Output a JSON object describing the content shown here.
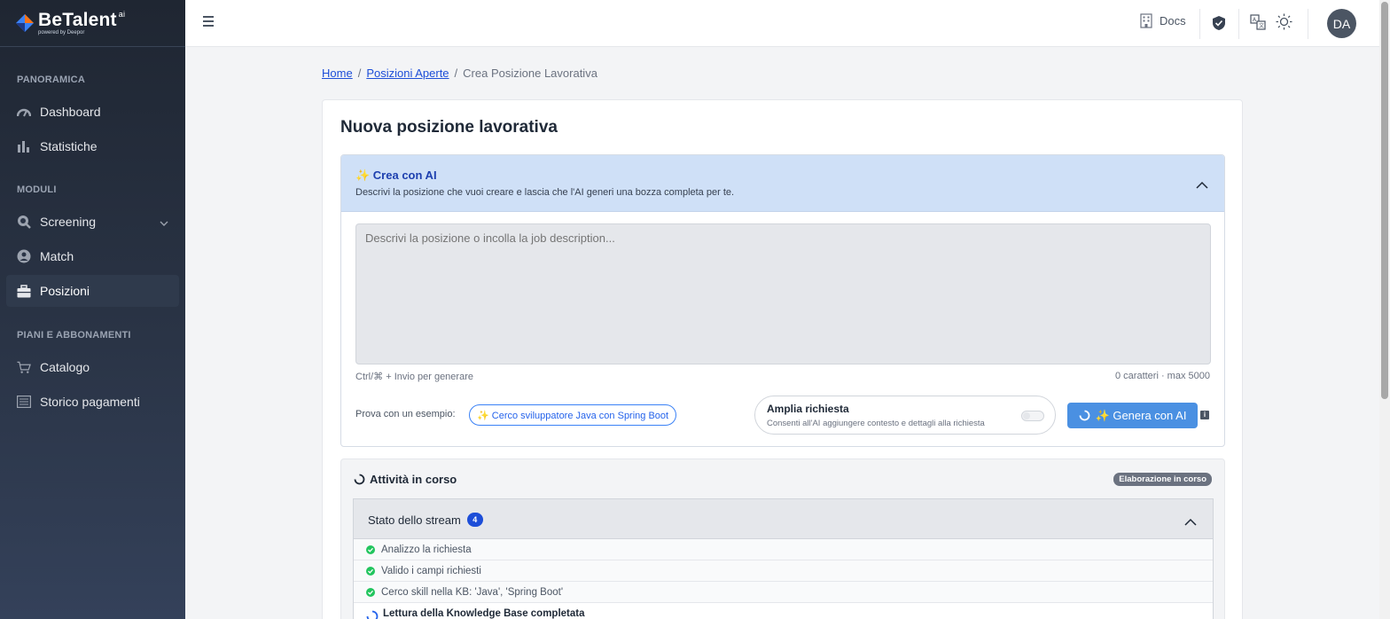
{
  "brand": {
    "name": "BeTalent",
    "suffix": "ai",
    "tagline": "powered by Deepor"
  },
  "sidebar": {
    "sections": [
      {
        "label": "PANORAMICA",
        "items": [
          {
            "label": "Dashboard",
            "icon": "dashboard-gauge-icon"
          },
          {
            "label": "Statistiche",
            "icon": "bar-chart-icon"
          }
        ]
      },
      {
        "label": "MODULI",
        "items": [
          {
            "label": "Screening",
            "icon": "search-icon"
          },
          {
            "label": "Match",
            "icon": "user-circle-icon"
          },
          {
            "label": "Posizioni",
            "icon": "briefcase-icon"
          }
        ]
      },
      {
        "label": "PIANI E ABBONAMENTI",
        "items": [
          {
            "label": "Catalogo",
            "icon": "cart-icon"
          },
          {
            "label": "Storico pagamenti",
            "icon": "list-icon"
          }
        ]
      }
    ],
    "active": "Posizioni"
  },
  "topbar": {
    "docs_label": "Docs",
    "avatar_initials": "DA"
  },
  "breadcrumb": {
    "home": "Home",
    "parent": "Posizioni Aperte",
    "current": "Crea Posizione Lavorativa",
    "sep": "/"
  },
  "page": {
    "title": "Nuova posizione lavorativa"
  },
  "ai_panel": {
    "title": "✨ Crea con AI",
    "description": "Descrivi la posizione che vuoi creare e lascia che l'AI generi una bozza completa per te.",
    "textarea_placeholder": "Descrivi la posizione o incolla la job description...",
    "shortcut_hint": "Ctrl/⌘ + Invio per generare",
    "char_count": "0 caratteri · max 5000",
    "example_label": "Prova con un esempio:",
    "example_chip": "✨ Cerco sviluppatore Java con Spring Boot",
    "amplia_title": "Amplia richiesta",
    "amplia_desc": "Consenti all'AI aggiungere contesto e dettagli alla richiesta",
    "generate_button": "✨ Genera con AI",
    "info_glyph": "i"
  },
  "activity": {
    "title": "Attività in corso",
    "badge": "Elaborazione in corso",
    "stream_title": "Stato dello stream",
    "stream_count": "4",
    "steps": [
      {
        "label": "Analizzo la richiesta",
        "status": "done"
      },
      {
        "label": "Valido i campi richiesti",
        "status": "done"
      },
      {
        "label": "Cerco skill nella KB: 'Java', 'Spring Boot'",
        "status": "done"
      },
      {
        "label": "Lettura della Knowledge Base completata",
        "status": "running"
      }
    ]
  },
  "colors": {
    "accent": "#4a90e2",
    "link": "#1d4ed8",
    "success": "#22c55e",
    "ai_header_bg": "#cfe0f7"
  }
}
